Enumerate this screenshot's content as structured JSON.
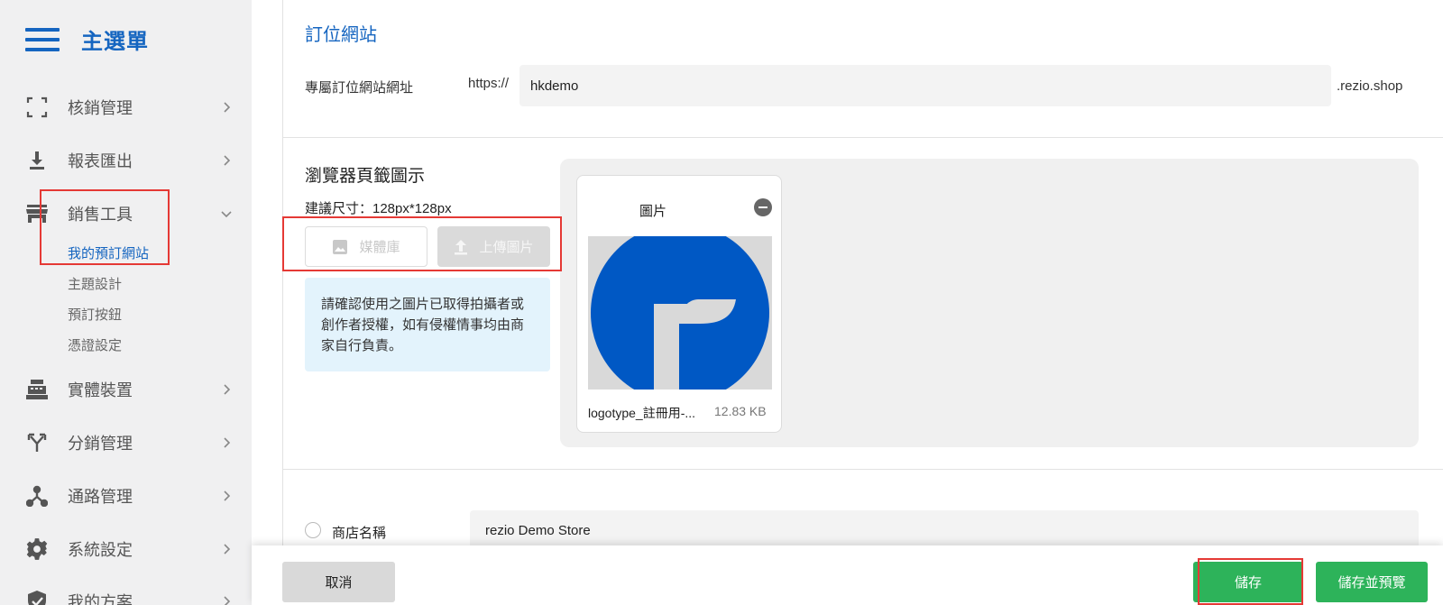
{
  "sidebar": {
    "title": "主選單",
    "items": [
      {
        "label": "核銷管理",
        "icon": "scan-icon"
      },
      {
        "label": "報表匯出",
        "icon": "download-icon"
      },
      {
        "label": "銷售工具",
        "icon": "store-icon"
      },
      {
        "label": "實體裝置",
        "icon": "cash-register-icon"
      },
      {
        "label": "分銷管理",
        "icon": "split-arrows-icon"
      },
      {
        "label": "通路管理",
        "icon": "channel-network-icon"
      },
      {
        "label": "系統設定",
        "icon": "gear-icon"
      },
      {
        "label": "我的方案",
        "icon": "shield-check-icon"
      }
    ],
    "sub_items": [
      "我的預訂網站",
      "主題設計",
      "預訂按鈕",
      "憑證設定"
    ],
    "active_sub": "我的預訂網站"
  },
  "booking_site": {
    "section_title": "訂位網站",
    "url_label": "專屬訂位網站網址",
    "url_prefix": "https://",
    "url_value": "hkdemo",
    "url_suffix": ".rezio.shop"
  },
  "favicon": {
    "title": "瀏覽器頁籤圖示",
    "recommended_size": "建議尺寸：128px*128px",
    "media_library_button": "媒體庫",
    "upload_button": "上傳圖片",
    "notice": "請確認使用之圖片已取得拍攝者或創作者授權，如有侵權情事均由商家自行負責。",
    "image_card": {
      "title": "圖片",
      "file_name": "logotype_註冊用-...",
      "file_size": "12.83 KB"
    }
  },
  "store": {
    "label": "商店名稱",
    "value": "rezio Demo Store"
  },
  "footer": {
    "cancel": "取消",
    "save": "儲存",
    "save_preview": "儲存並預覽"
  },
  "colors": {
    "accent": "#1565c0",
    "green": "#2db35a",
    "highlight": "#e53935"
  }
}
